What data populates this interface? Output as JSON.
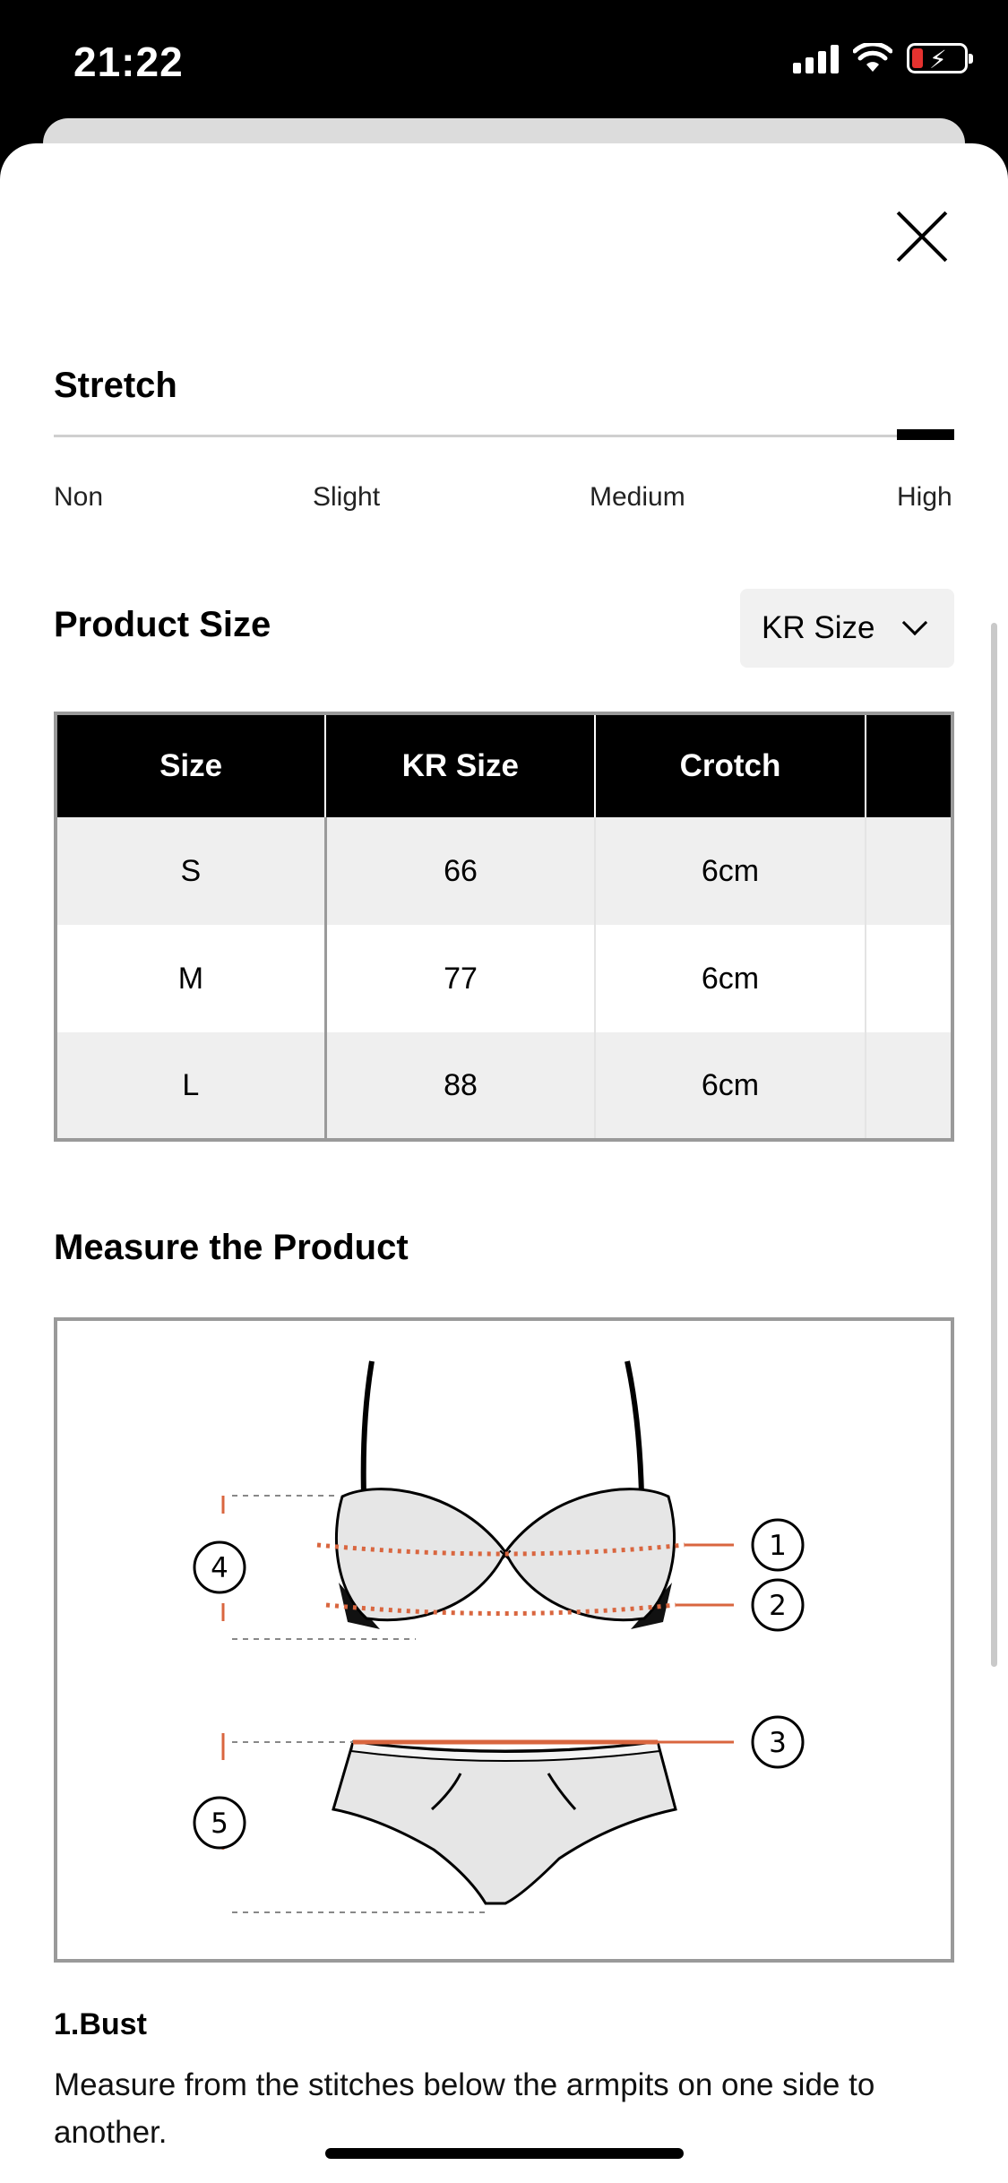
{
  "status": {
    "time": "21:22"
  },
  "stretch": {
    "title": "Stretch",
    "levels": [
      "Non",
      "Slight",
      "Medium",
      "High"
    ],
    "selected": "High"
  },
  "product_size": {
    "title": "Product Size",
    "unit_select": "KR Size",
    "table": {
      "headers": [
        "Size",
        "KR Size",
        "Crotch",
        ""
      ],
      "rows": [
        [
          "S",
          "66",
          "6cm",
          ""
        ],
        [
          "M",
          "77",
          "6cm",
          ""
        ],
        [
          "L",
          "88",
          "6cm",
          ""
        ]
      ]
    }
  },
  "measure": {
    "title": "Measure the Product",
    "markers": [
      "1",
      "2",
      "3",
      "4",
      "5"
    ],
    "accent_color": "#d9663f"
  },
  "notes": {
    "bust_title": "1.Bust",
    "bust_desc": "Measure from the stitches below the armpits on one side to another."
  }
}
